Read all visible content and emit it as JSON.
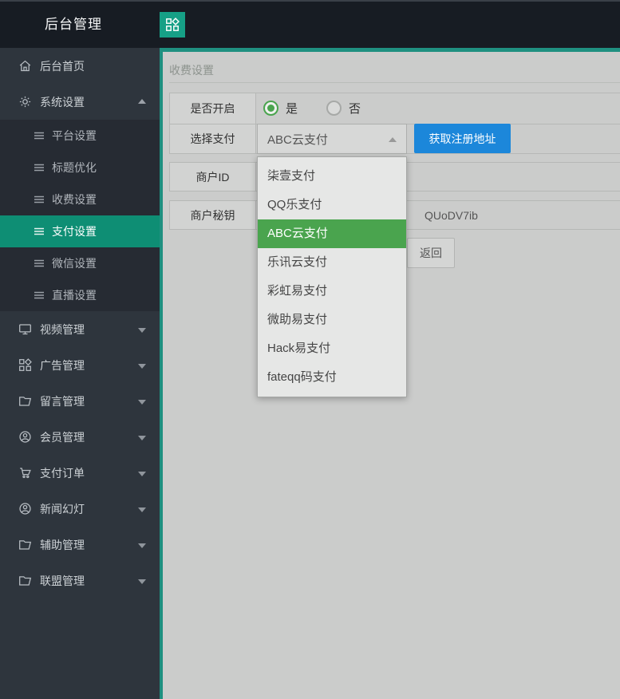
{
  "app": {
    "title": "后台管理"
  },
  "colors": {
    "accent_teal": "#1f9080",
    "active_menu_teal": "#0e8e74",
    "apps_button_teal": "#16a086",
    "primary_button_blue": "#1c87da",
    "selected_option_green": "#4aa44e"
  },
  "sidebar": {
    "items": [
      {
        "label": "后台首页",
        "icon": "home-icon"
      },
      {
        "label": "系统设置",
        "icon": "gear-icon",
        "expanded": true,
        "children": [
          {
            "label": "平台设置",
            "active": false
          },
          {
            "label": "标题优化",
            "active": false
          },
          {
            "label": "收费设置",
            "active": false
          },
          {
            "label": "支付设置",
            "active": true
          },
          {
            "label": "微信设置",
            "active": false
          },
          {
            "label": "直播设置",
            "active": false
          }
        ]
      },
      {
        "label": "视频管理",
        "icon": "monitor-icon"
      },
      {
        "label": "广告管理",
        "icon": "grid-icon"
      },
      {
        "label": "留言管理",
        "icon": "folder-icon"
      },
      {
        "label": "会员管理",
        "icon": "user-circle-icon"
      },
      {
        "label": "支付订单",
        "icon": "cart-icon"
      },
      {
        "label": "新闻幻灯",
        "icon": "user-circle-icon"
      },
      {
        "label": "辅助管理",
        "icon": "folder-icon"
      },
      {
        "label": "联盟管理",
        "icon": "folder-icon"
      }
    ]
  },
  "main": {
    "panel_title": "收费设置",
    "form": {
      "enable_label": "是否开启",
      "enable_options": [
        {
          "label": "是",
          "selected": true
        },
        {
          "label": "否",
          "selected": false
        }
      ],
      "payment_label": "选择支付",
      "payment_selected": "ABC云支付",
      "register_button": "获取注册地址",
      "merchant_id_label": "商户ID",
      "merchant_id_value": "",
      "merchant_key_label": "商户秘钥",
      "merchant_key_visible_value": "QUoDV7ib",
      "back_button": "返回"
    },
    "dropdown": {
      "selected_index": 2,
      "options": [
        "柒壹支付",
        "QQ乐支付",
        "ABC云支付",
        "乐讯云支付",
        "彩虹易支付",
        "微助易支付",
        "Hack易支付",
        "fateqq码支付"
      ]
    }
  }
}
